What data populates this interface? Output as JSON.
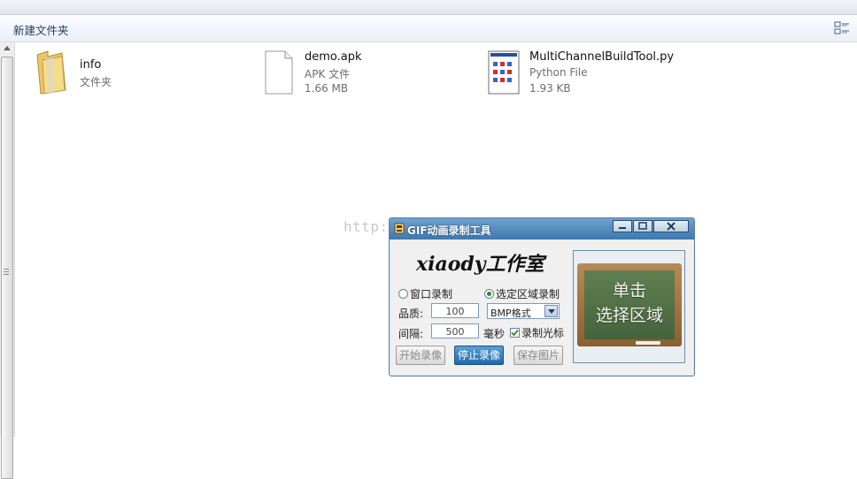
{
  "toolbar": {
    "new_folder": "新建文件夹"
  },
  "files": [
    {
      "name": "info",
      "type": "文件夹",
      "size": ""
    },
    {
      "name": "demo.apk",
      "type": "APK 文件",
      "size": "1.66 MB"
    },
    {
      "name": "MultiChannelBuildTool.py",
      "type": "Python File",
      "size": "1.93 KB"
    }
  ],
  "watermark": "http://blog.csdn.net/",
  "gif_tool": {
    "title": "GIF动画录制工具",
    "brand": "xiaody工作室",
    "mode_window": "窗口录制",
    "mode_region": "选定区域录制",
    "selected_mode": "region",
    "quality_label": "品质:",
    "quality_value": "100",
    "format_value": "BMP格式",
    "interval_label": "间隔:",
    "interval_value": "500",
    "interval_unit": "毫秒",
    "record_cursor": "录制光标",
    "record_cursor_checked": true,
    "btn_start": "开始录像",
    "btn_stop": "停止录像",
    "btn_save": "保存图片",
    "board_line1": "单击",
    "board_line2": "选择区域"
  },
  "colors": {
    "title_bar": "#3d78ad",
    "active_button": "#1e6aab",
    "chalkboard": "#4f6d44"
  }
}
